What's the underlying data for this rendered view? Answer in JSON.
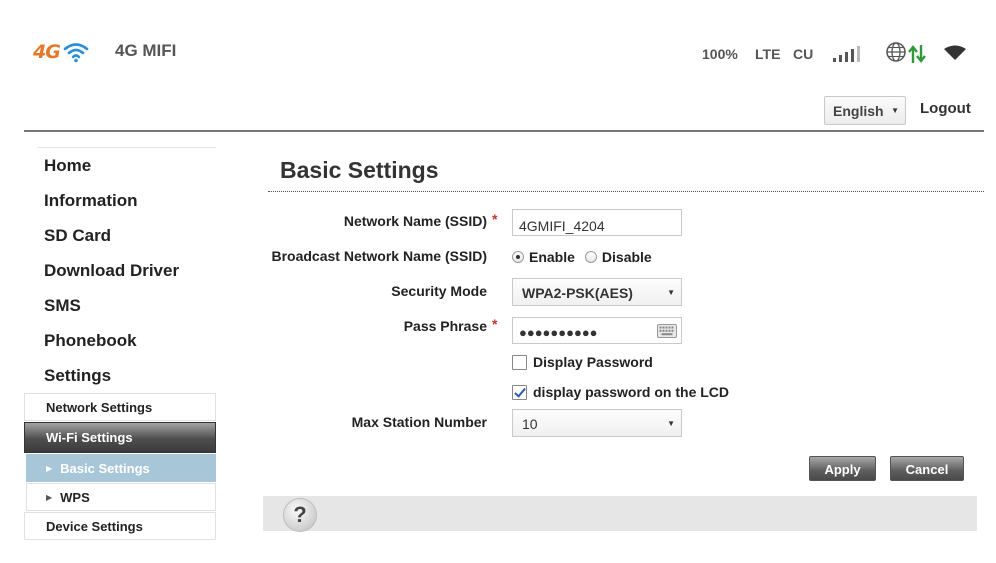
{
  "header": {
    "logo_text": "4G",
    "brand": "4G MIFI",
    "status": {
      "battery": "100%",
      "network_type": "LTE",
      "operator": "CU",
      "signal_bars": 4,
      "icons": [
        "signal-icon",
        "globe-icon",
        "data-transfer-icon",
        "wifi-icon"
      ]
    },
    "language": "English",
    "logout_label": "Logout"
  },
  "sidebar": {
    "items": [
      {
        "label": "Home"
      },
      {
        "label": "Information"
      },
      {
        "label": "SD Card"
      },
      {
        "label": "Download Driver"
      },
      {
        "label": "SMS"
      },
      {
        "label": "Phonebook"
      },
      {
        "label": "Settings"
      }
    ],
    "settings_sub": [
      {
        "label": "Network Settings"
      },
      {
        "label": "Wi-Fi Settings"
      },
      {
        "label": "Device Settings"
      }
    ],
    "wifi_sub": [
      {
        "label": "Basic Settings"
      },
      {
        "label": "WPS"
      }
    ]
  },
  "main": {
    "title": "Basic Settings",
    "fields": {
      "ssid_label": "Network Name (SSID)",
      "ssid_value": "4GMIFI_4204",
      "broadcast_label": "Broadcast Network Name (SSID)",
      "broadcast_enable": "Enable",
      "broadcast_disable": "Disable",
      "broadcast_selected": "Enable",
      "security_label": "Security Mode",
      "security_value": "WPA2-PSK(AES)",
      "passphrase_label": "Pass Phrase",
      "passphrase_masked": "●●●●●●●●●●",
      "display_password_label": "Display Password",
      "display_password_checked": false,
      "display_lcd_label": "display password on the LCD",
      "display_lcd_checked": true,
      "max_station_label": "Max Station Number",
      "max_station_value": "10",
      "required_mark": "*"
    },
    "buttons": {
      "apply": "Apply",
      "cancel": "Cancel"
    },
    "help_symbol": "?"
  },
  "colors": {
    "accent_orange": "#e4792a",
    "wifi_blue": "#2b8fd8",
    "arrows_green": "#2e9a3a",
    "selected_item": "#a7c6d8",
    "required": "#c0392b"
  }
}
